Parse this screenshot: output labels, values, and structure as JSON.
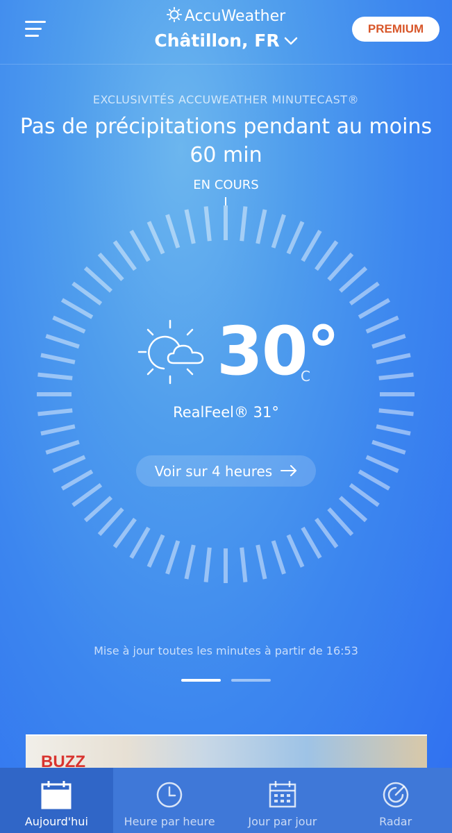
{
  "header": {
    "brand": "AccuWeather",
    "location": "Châtillon, FR",
    "premium_label": "PREMIUM"
  },
  "minutecast": {
    "kicker": "EXCLUSIVITÉS ACCUWEATHER MINUTECAST®",
    "headline": "Pas de précipitations pendant au moins 60 min",
    "now_label": "EN COURS"
  },
  "current": {
    "temperature": "30°",
    "unit": "C",
    "realfeel_label": "RealFeel®",
    "realfeel_value": "31°",
    "condition_icon": "partly-sunny-icon"
  },
  "actions": {
    "four_hours_label": "Voir sur 4 heures"
  },
  "update_text": "Mise à jour toutes les minutes à partir de 16:53",
  "pager": {
    "pages": 2,
    "active": 1
  },
  "ad": {
    "text": "BUZZ"
  },
  "nav": {
    "items": [
      {
        "label": "Aujourd'hui",
        "icon": "calendar-icon",
        "active": true
      },
      {
        "label": "Heure par heure",
        "icon": "clock-icon",
        "active": false
      },
      {
        "label": "Jour par jour",
        "icon": "calendar-grid-icon",
        "active": false
      },
      {
        "label": "Radar",
        "icon": "radar-icon",
        "active": false
      }
    ]
  },
  "colors": {
    "premium_text": "#d8572a",
    "nav_bg": "#3f78d8",
    "nav_active_bg": "#3066c7"
  }
}
